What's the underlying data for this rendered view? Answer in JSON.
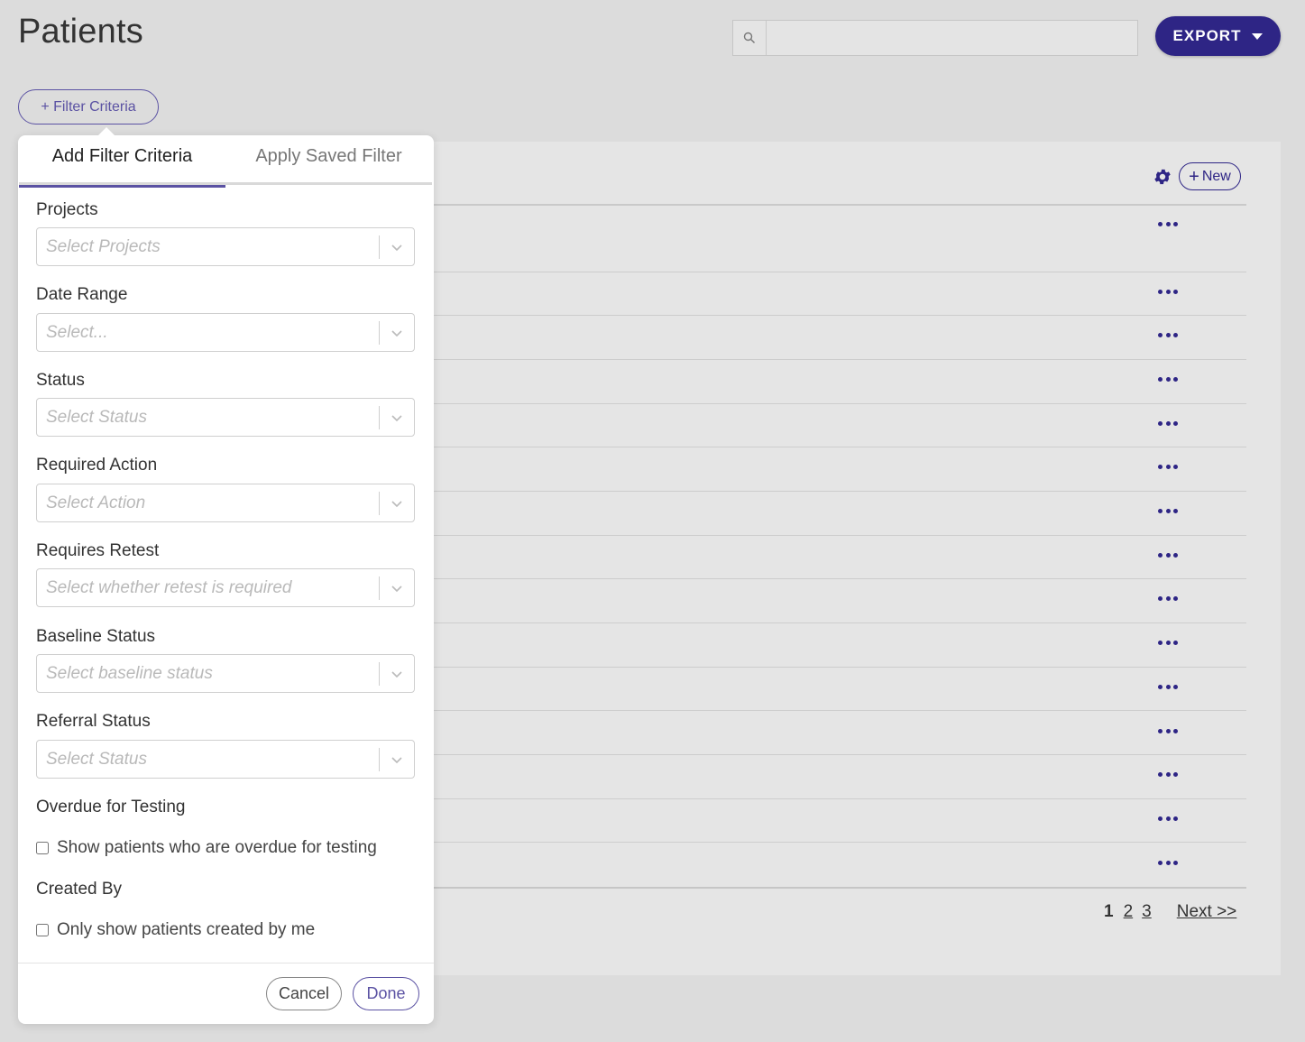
{
  "page": {
    "title": "Patients"
  },
  "search": {
    "value": "",
    "placeholder": ""
  },
  "header": {
    "export_label": "EXPORT",
    "filter_button_label": "+ Filter Criteria"
  },
  "table": {
    "new_label": "New",
    "row_count": 15
  },
  "pagination": {
    "current": "1",
    "pages": [
      "2",
      "3"
    ],
    "next_label": "Next >>"
  },
  "filter_panel": {
    "tabs": [
      "Add Filter Criteria",
      "Apply Saved Filter"
    ],
    "fields": [
      {
        "label": "Projects",
        "placeholder": "Select Projects"
      },
      {
        "label": "Date Range",
        "placeholder": "Select..."
      },
      {
        "label": "Status",
        "placeholder": "Select Status"
      },
      {
        "label": "Required Action",
        "placeholder": "Select Action"
      },
      {
        "label": "Requires Retest",
        "placeholder": "Select whether retest is required"
      },
      {
        "label": "Baseline Status",
        "placeholder": "Select baseline status"
      },
      {
        "label": "Referral Status",
        "placeholder": "Select Status"
      }
    ],
    "overdue": {
      "label": "Overdue for Testing",
      "checkbox": "Show patients who are overdue for testing",
      "checked": false
    },
    "created_by": {
      "label": "Created By",
      "checkbox": "Only show patients created by me",
      "checked": false
    },
    "cancel_label": "Cancel",
    "done_label": "Done"
  },
  "colors": {
    "brand": "#2e2585",
    "accent": "#5b52a3",
    "background": "#dcdcdc"
  }
}
